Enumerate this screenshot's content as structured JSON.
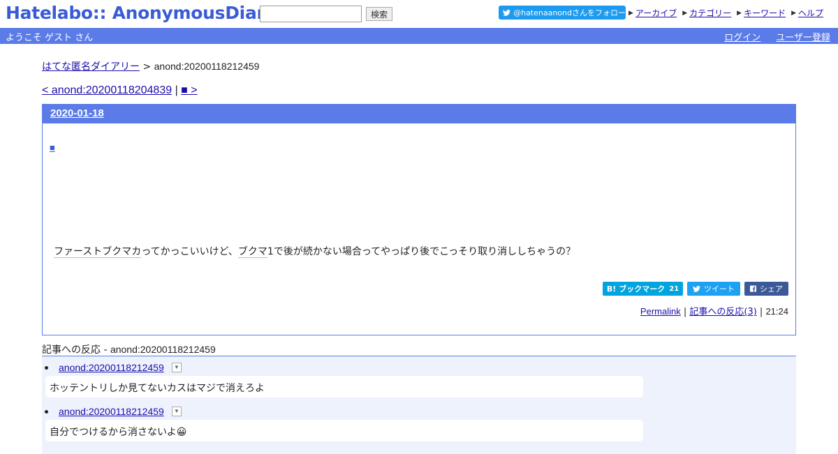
{
  "site": {
    "logo": "Hatelabo:: AnonymousDiary",
    "search_placeholder": "",
    "search_button": "検索",
    "follow_button": "@hatenaanondさんをフォロー",
    "nav": [
      "アーカイブ",
      "カテゴリー",
      "キーワード",
      "ヘルプ"
    ]
  },
  "userbar": {
    "welcome": "ようこそ ゲスト さん",
    "login": "ログイン",
    "register": "ユーザー登録"
  },
  "breadcrumb": {
    "home": "はてな匿名ダイアリー",
    "separator": " > ",
    "current": "anond:20200118212459"
  },
  "prevnext": {
    "prev": "< anond:20200118204839",
    "separator": " | ",
    "next": "■ >"
  },
  "entry": {
    "date": "2020-01-18",
    "section_mark": "■",
    "body": {
      "kw1": "ファーストブクマカ",
      "t1": "ってかっこいいけど、",
      "kw2": "ブクマ",
      "t2": "1で後が続かない場合ってやっぱり後でこっそり取り消ししちゃうの？"
    },
    "share": {
      "hatena_label": "ブックマーク",
      "hatena_count": "21",
      "tweet_label": "ツイート",
      "fb_label": "シェア"
    },
    "footer": {
      "permalink": "Permalink",
      "reactions_link": "記事への反応(3)",
      "time": "21:24"
    }
  },
  "reactions": {
    "heading_prefix": "記事への反応 - ",
    "heading_id": "anond:20200118212459",
    "items": [
      {
        "id": "anond:20200118212459",
        "text": "ホッテントリしか見てないカスはマジで消えろよ"
      },
      {
        "id": "anond:20200118212459",
        "text": "自分でつけるから消さないよ😀"
      }
    ]
  },
  "colors": {
    "accent": "#5b7ce8",
    "link": "#1a0dab",
    "reaction_bg": "#eef2fc",
    "hatena_btn": "#00a4de",
    "tweet_btn": "#1da1f2",
    "fb_btn": "#3b5998"
  }
}
